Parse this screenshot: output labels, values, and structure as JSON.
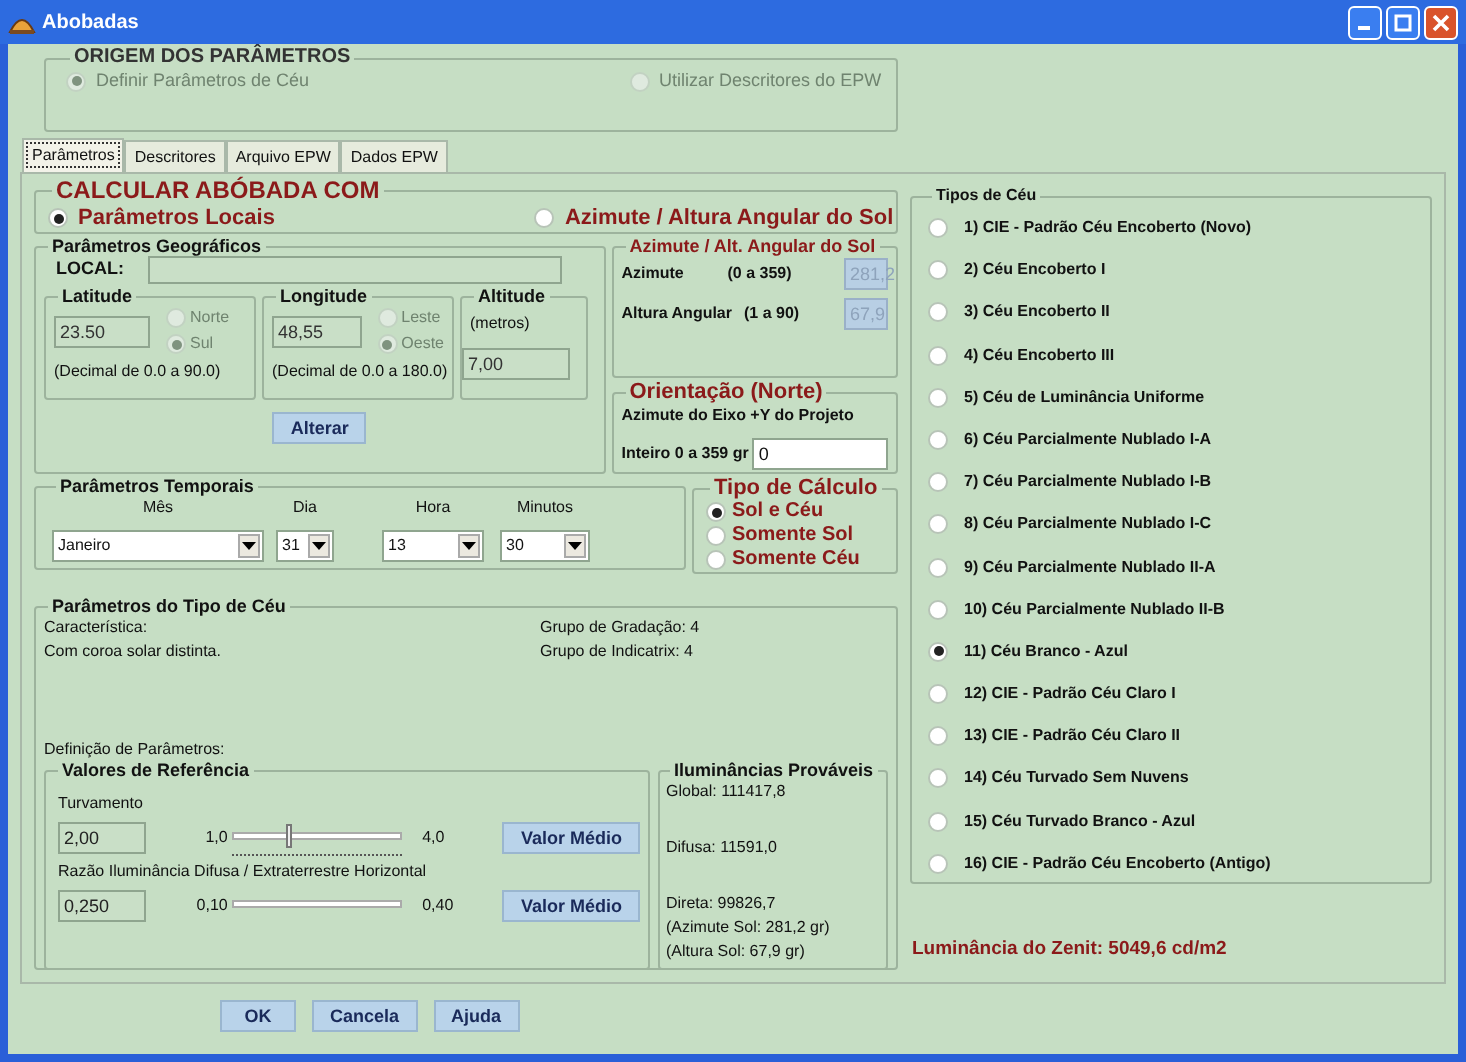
{
  "window": {
    "title": "Abobadas"
  },
  "origem": {
    "title": "ORIGEM DOS PARÂMETROS",
    "options": [
      {
        "label": "Definir Parâmetros de Céu",
        "selected": true,
        "disabled": true
      },
      {
        "label": "Utilizar Descritores do EPW",
        "selected": false,
        "disabled": true
      }
    ]
  },
  "tabs": [
    {
      "label": "Parâmetros",
      "selected": true
    },
    {
      "label": "Descritores",
      "selected": false
    },
    {
      "label": "Arquivo EPW",
      "selected": false
    },
    {
      "label": "Dados EPW",
      "selected": false
    }
  ],
  "calcular": {
    "title": "CALCULAR ABÓBADA COM",
    "options": [
      {
        "label": "Parâmetros Locais",
        "selected": true
      },
      {
        "label": "Azimute / Altura Angular do Sol",
        "selected": false
      }
    ]
  },
  "geograficos": {
    "title": "Parâmetros Geográficos",
    "local_label": "LOCAL:",
    "latitude": {
      "title": "Latitude",
      "value": "23.50",
      "hint": "(Decimal de 0.0 a 90.0)",
      "options": [
        {
          "label": "Norte",
          "selected": false,
          "disabled": true
        },
        {
          "label": "Sul",
          "selected": true,
          "disabled": true
        }
      ]
    },
    "longitude": {
      "title": "Longitude",
      "value": "48,55",
      "hint": "(Decimal de 0.0 a 180.0)",
      "options": [
        {
          "label": "Leste",
          "selected": false,
          "disabled": true
        },
        {
          "label": "Oeste",
          "selected": true,
          "disabled": true
        }
      ]
    },
    "altitude": {
      "title": "Altitude",
      "unit": "(metros)",
      "value": "7,00"
    },
    "button": "Alterar"
  },
  "sol": {
    "title": "Azimute / Alt. Angular do Sol",
    "fields": [
      {
        "label": "Azimute",
        "range": "(0 a 359)",
        "value": "281,2"
      },
      {
        "label": "Altura Angular",
        "range": "(1 a 90)",
        "value": "67,9"
      }
    ]
  },
  "orientacao": {
    "title": "Orientação (Norte)",
    "description": "Azimute do Eixo +Y do Projeto",
    "label": "Inteiro 0 a 359 gr",
    "value": "0"
  },
  "temporais": {
    "title": "Parâmetros Temporais",
    "fields": [
      {
        "label": "Mês",
        "value": "Janeiro"
      },
      {
        "label": "Dia",
        "value": "31"
      },
      {
        "label": "Hora",
        "value": "13"
      },
      {
        "label": "Minutos",
        "value": "30"
      }
    ]
  },
  "tipo_calculo": {
    "title": "Tipo de Cálculo",
    "options": [
      {
        "label": "Sol e Céu",
        "selected": true
      },
      {
        "label": "Somente Sol",
        "selected": false
      },
      {
        "label": "Somente Céu",
        "selected": false
      }
    ]
  },
  "parametros_ceu": {
    "title": "Parâmetros do Tipo de Céu",
    "caracteristica_label": "Característica:",
    "caracteristica": "Com coroa solar distinta.",
    "grupos": [
      "Grupo de Gradação: 4",
      "Grupo de Indicatrix: 4"
    ],
    "definicao_label": "Definição de Parâmetros:",
    "referencia": {
      "title": "Valores de Referência",
      "sliders": [
        {
          "label": "Turvamento",
          "value": "2,00",
          "min": "1,0",
          "max": "4,0",
          "level": 0.33,
          "ticks": true,
          "button": "Valor Médio"
        },
        {
          "label": "Razão Iluminância Difusa / Extraterrestre Horizontal",
          "value": "0,250",
          "min": "0,10",
          "max": "0,40",
          "ticks": false,
          "button": "Valor Médio"
        }
      ]
    },
    "iluminancias": {
      "title": "Iluminâncias Prováveis",
      "lines": [
        "Global: 111417,8",
        "Difusa: 11591,0",
        "Direta: 99826,7",
        "(Azimute Sol: 281,2 gr)",
        "(Altura Sol: 67,9 gr)"
      ]
    }
  },
  "tipos_ceu": {
    "title": "Tipos de Céu",
    "options": [
      {
        "label": "1) CIE  - Padrão Céu Encoberto (Novo)",
        "selected": false
      },
      {
        "label": "2) Céu Encoberto I",
        "selected": false
      },
      {
        "label": "3) Céu Encoberto II",
        "selected": false
      },
      {
        "label": "4) Céu Encoberto III",
        "selected": false
      },
      {
        "label": "5) Céu de Luminância Uniforme",
        "selected": false
      },
      {
        "label": "6) Céu Parcialmente Nublado I-A",
        "selected": false
      },
      {
        "label": "7) Céu Parcialmente Nublado I-B",
        "selected": false
      },
      {
        "label": "8) Céu Parcialmente Nublado I-C",
        "selected": false
      },
      {
        "label": "9) Céu Parcialmente Nublado II-A",
        "selected": false
      },
      {
        "label": "10) Céu Parcialmente Nublado II-B",
        "selected": false
      },
      {
        "label": "11) Céu Branco - Azul",
        "selected": true
      },
      {
        "label": "12) CIE  - Padrão Céu Claro I",
        "selected": false
      },
      {
        "label": "13) CIE  - Padrão Céu Claro II",
        "selected": false
      },
      {
        "label": "14) Céu Turvado Sem Nuvens",
        "selected": false
      },
      {
        "label": "15) Céu Turvado Branco - Azul",
        "selected": false
      },
      {
        "label": "16) CIE  - Padrão Céu Encoberto (Antigo)",
        "selected": false
      }
    ]
  },
  "zenite": "Luminância do Zenit: 5049,6 cd/m2",
  "buttons": [
    "OK",
    "Cancela",
    "Ajuda"
  ]
}
